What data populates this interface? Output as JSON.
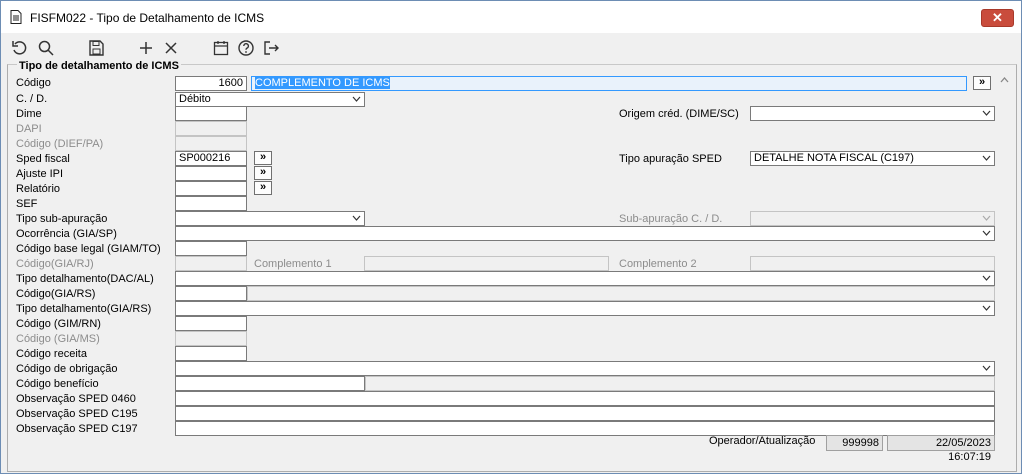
{
  "window": {
    "title": "FISFM022 - Tipo de Detalhamento de ICMS",
    "close_label": "✕"
  },
  "toolbar": {
    "icons": [
      "undo-icon",
      "search-icon",
      "save-icon",
      "add-icon",
      "delete-icon",
      "calendar-icon",
      "help-icon",
      "exit-icon"
    ]
  },
  "section": {
    "title": "Tipo de detalhamento de ICMS"
  },
  "fields": {
    "codigo": {
      "label": "Código",
      "value": "1600",
      "desc": "COMPLEMENTO DE ICMS"
    },
    "cd": {
      "label": "C. / D.",
      "value": "Débito"
    },
    "dime": {
      "label": "Dime",
      "value": ""
    },
    "origem": {
      "label": "Origem créd. (DIME/SC)",
      "value": ""
    },
    "dapi": {
      "label": "DAPI"
    },
    "dief": {
      "label": "Código (DIEF/PA)"
    },
    "sped": {
      "label": "Sped fiscal",
      "value": "SP000216"
    },
    "tipo_apuracao": {
      "label": "Tipo apuração SPED",
      "value": "DETALHE NOTA FISCAL (C197)"
    },
    "ajuste_ipi": {
      "label": "Ajuste IPI",
      "value": ""
    },
    "relatorio": {
      "label": "Relatório",
      "value": ""
    },
    "sef": {
      "label": "SEF",
      "value": ""
    },
    "sub_apuracao": {
      "label": "Tipo sub-apuração",
      "value": ""
    },
    "sub_apuracao_cd": {
      "label": "Sub-apuração C. / D."
    },
    "ocorrencia": {
      "label": "Ocorrência (GIA/SP)",
      "value": ""
    },
    "base_legal": {
      "label": "Código base legal (GIAM/TO)",
      "value": ""
    },
    "gia_rj": {
      "label": "Código(GIA/RJ)",
      "comp1": "Complemento 1",
      "comp2": "Complemento 2"
    },
    "dac_al": {
      "label": "Tipo detalhamento(DAC/AL)",
      "value": ""
    },
    "gia_rs": {
      "label": "Código(GIA/RS)",
      "value": ""
    },
    "det_gia_rs": {
      "label": "Tipo detalhamento(GIA/RS)",
      "value": ""
    },
    "gim_rn": {
      "label": "Código (GIM/RN)",
      "value": ""
    },
    "gia_ms": {
      "label": "Código (GIA/MS)"
    },
    "receita": {
      "label": "Código receita",
      "value": ""
    },
    "obrigacao": {
      "label": "Código de obrigação",
      "value": ""
    },
    "beneficio": {
      "label": "Código benefício",
      "value": ""
    },
    "obs_0460": {
      "label": "Observação SPED 0460",
      "value": ""
    },
    "obs_c195": {
      "label": "Observação SPED C195",
      "value": ""
    },
    "obs_c197": {
      "label": "Observação SPED C197",
      "value": ""
    }
  },
  "lookup_label": "»",
  "status": {
    "label": "Operador/Atualização",
    "operator": "999998",
    "timestamp": "22/05/2023 16:07:19"
  }
}
